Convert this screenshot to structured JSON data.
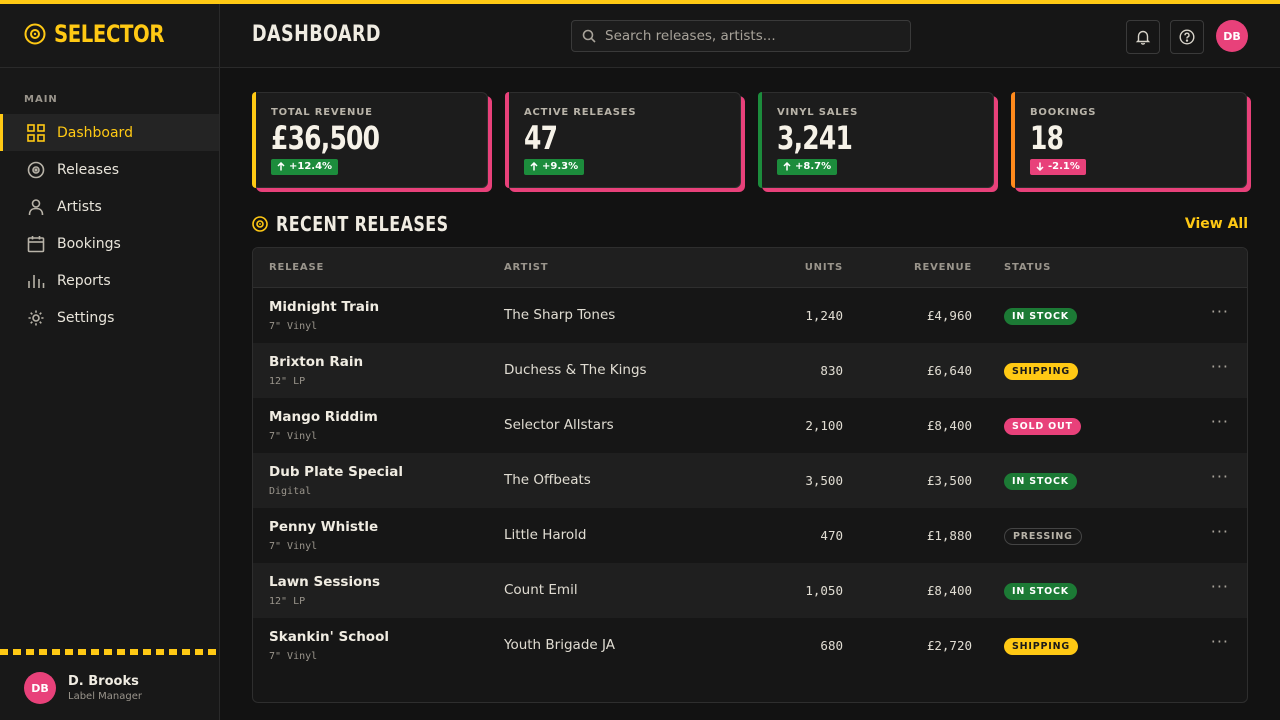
{
  "brand": {
    "name": "SELECTOR"
  },
  "sidebar": {
    "section_label": "MAIN",
    "items": [
      {
        "label": "Dashboard",
        "icon": "grid-icon",
        "active": true
      },
      {
        "label": "Releases",
        "icon": "record-icon"
      },
      {
        "label": "Artists",
        "icon": "person-icon"
      },
      {
        "label": "Bookings",
        "icon": "calendar-icon"
      },
      {
        "label": "Reports",
        "icon": "bar-chart-icon"
      },
      {
        "label": "Settings",
        "icon": "gear-icon"
      }
    ],
    "user": {
      "initials": "DB",
      "name": "D. Brooks",
      "role": "Label Manager"
    }
  },
  "header": {
    "title": "DASHBOARD",
    "search_placeholder": "Search releases, artists...",
    "avatar_initials": "DB"
  },
  "stats": [
    {
      "label": "TOTAL REVENUE",
      "value": "£36,500",
      "delta": "+12.4%",
      "direction": "up"
    },
    {
      "label": "ACTIVE RELEASES",
      "value": "47",
      "delta": "+9.3%",
      "direction": "up"
    },
    {
      "label": "VINYL SALES",
      "value": "3,241",
      "delta": "+8.7%",
      "direction": "up"
    },
    {
      "label": "BOOKINGS",
      "value": "18",
      "delta": "-2.1%",
      "direction": "down"
    }
  ],
  "recent": {
    "title": "RECENT RELEASES",
    "view_all": "View All",
    "columns": {
      "release": "RELEASE",
      "artist": "ARTIST",
      "units": "UNITS",
      "revenue": "REVENUE",
      "status": "STATUS"
    },
    "rows": [
      {
        "title": "Midnight Train",
        "format": "7\" Vinyl",
        "artist": "The Sharp Tones",
        "units": "1,240",
        "revenue": "£4,960",
        "status": "IN STOCK"
      },
      {
        "title": "Brixton Rain",
        "format": "12\" LP",
        "artist": "Duchess & The Kings",
        "units": "830",
        "revenue": "£6,640",
        "status": "SHIPPING"
      },
      {
        "title": "Mango Riddim",
        "format": "7\" Vinyl",
        "artist": "Selector Allstars",
        "units": "2,100",
        "revenue": "£8,400",
        "status": "SOLD OUT"
      },
      {
        "title": "Dub Plate Special",
        "format": "Digital",
        "artist": "The Offbeats",
        "units": "3,500",
        "revenue": "£3,500",
        "status": "IN STOCK"
      },
      {
        "title": "Penny Whistle",
        "format": "7\" Vinyl",
        "artist": "Little Harold",
        "units": "470",
        "revenue": "£1,880",
        "status": "PRESSING"
      },
      {
        "title": "Lawn Sessions",
        "format": "12\" LP",
        "artist": "Count Emil",
        "units": "1,050",
        "revenue": "£8,400",
        "status": "IN STOCK"
      },
      {
        "title": "Skankin' School",
        "format": "7\" Vinyl",
        "artist": "Youth Brigade JA",
        "units": "680",
        "revenue": "£2,720",
        "status": "SHIPPING"
      }
    ]
  },
  "colors": {
    "accent": "#ffc914",
    "pink": "#e8417a",
    "green": "#1c8c3c",
    "orange": "#ff8a1c"
  }
}
